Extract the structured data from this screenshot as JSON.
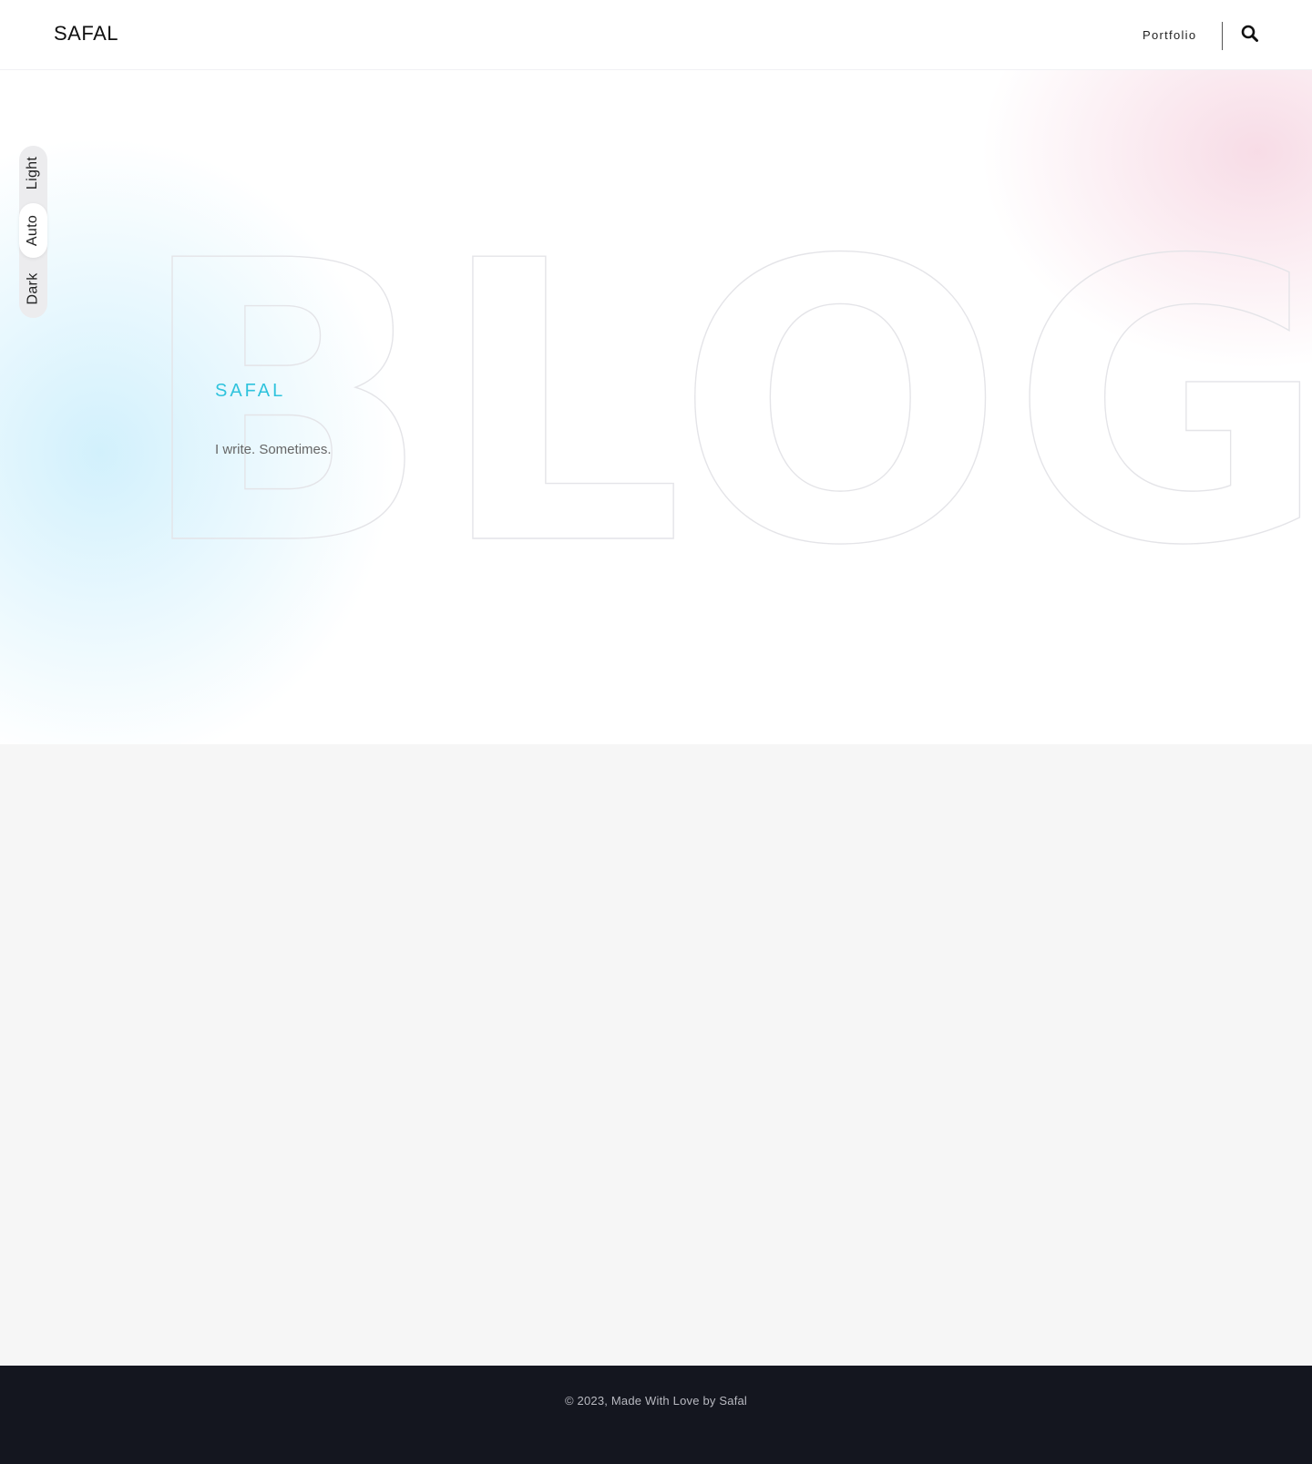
{
  "header": {
    "logo": "SAFAL",
    "nav": {
      "portfolio": "Portfolio"
    },
    "search_icon": "search-icon"
  },
  "theme_switcher": {
    "options": [
      "Light",
      "Auto",
      "Dark"
    ],
    "selected": "Auto"
  },
  "hero": {
    "background_word": "BLOG",
    "kicker": "SAFAL",
    "tagline": "I write. Sometimes."
  },
  "footer": {
    "copyright": "© 2023, Made With Love by Safal"
  },
  "colors": {
    "accent": "#2fc3dd",
    "cursor_ring": "#f3a9c6",
    "footer_bg": "#14161f",
    "content_bg": "#f6f6f6"
  }
}
